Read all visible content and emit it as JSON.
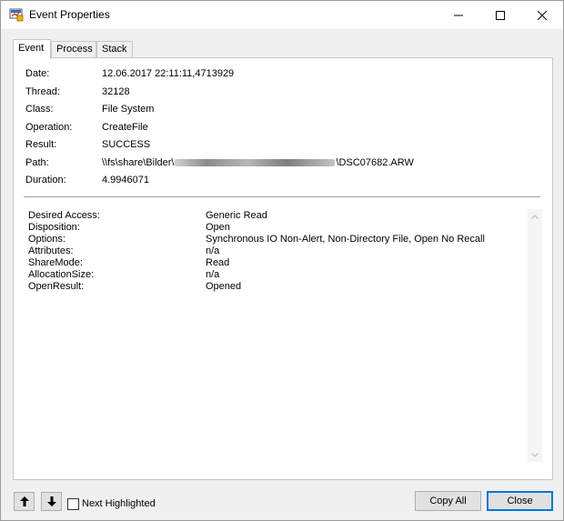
{
  "window": {
    "title": "Event Properties",
    "icon": "monitor-app-icon"
  },
  "tabs": [
    {
      "label": "Event",
      "active": true
    },
    {
      "label": "Process",
      "active": false
    },
    {
      "label": "Stack",
      "active": false
    }
  ],
  "properties": [
    {
      "label": "Date:",
      "value": "12.06.2017 22:11:11,4713929"
    },
    {
      "label": "Thread:",
      "value": "32128"
    },
    {
      "label": "Class:",
      "value": "File System"
    },
    {
      "label": "Operation:",
      "value": "CreateFile"
    },
    {
      "label": "Result:",
      "value": "SUCCESS"
    },
    {
      "label": "Path:",
      "value_prefix": "\\\\fs\\share\\Bilder\\",
      "value_suffix": "\\DSC07682.ARW"
    },
    {
      "label": "Duration:",
      "value": "4.9946071"
    }
  ],
  "details": [
    {
      "label": "Desired Access:",
      "value": "Generic Read"
    },
    {
      "label": "Disposition:",
      "value": "Open"
    },
    {
      "label": "Options:",
      "value": "Synchronous IO Non-Alert, Non-Directory File, Open No Recall"
    },
    {
      "label": "Attributes:",
      "value": "n/a"
    },
    {
      "label": "ShareMode:",
      "value": "Read"
    },
    {
      "label": "AllocationSize:",
      "value": "n/a"
    },
    {
      "label": "OpenResult:",
      "value": "Opened"
    }
  ],
  "footer": {
    "checkbox_label": "Next Highlighted",
    "checkbox_checked": false,
    "copy_all_label": "Copy All",
    "close_label": "Close"
  },
  "colors": {
    "accent": "#0078d7",
    "window_bg": "#f0f0f0"
  }
}
